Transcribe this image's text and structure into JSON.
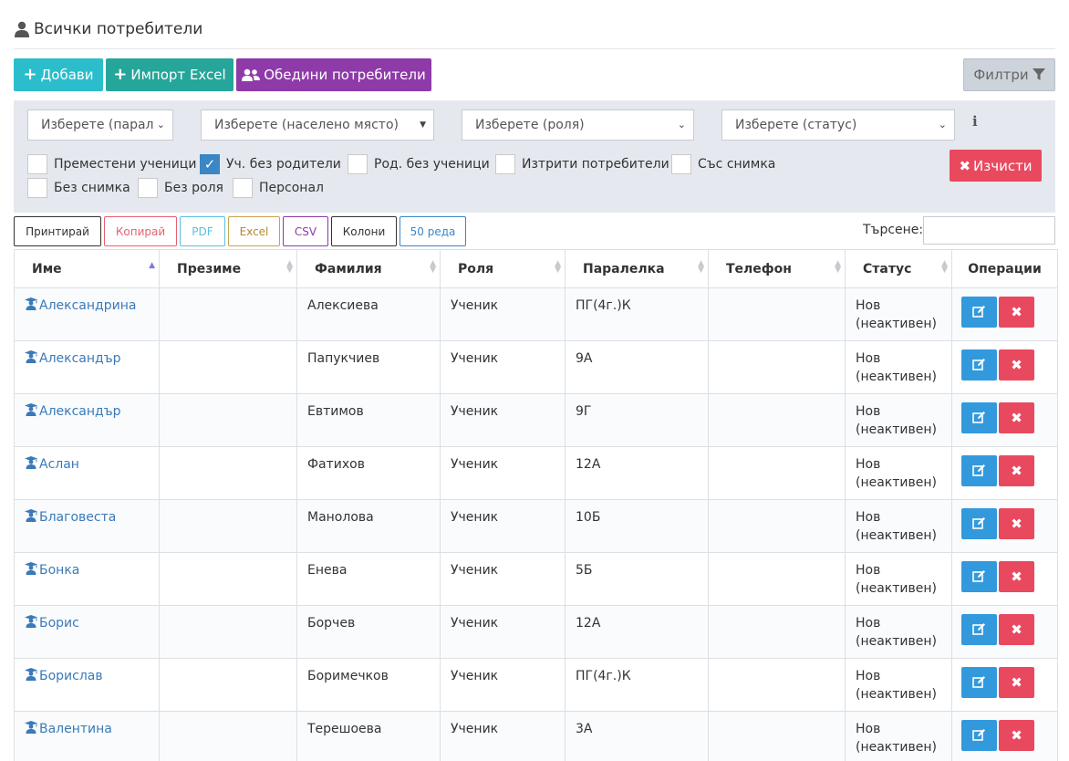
{
  "header": {
    "title": "Всички потребители"
  },
  "toolbar": {
    "add_label": "Добави",
    "import_label": "Импорт Excel",
    "merge_label": "Обедини потребители",
    "filters_label": "Филтри"
  },
  "filters": {
    "class_select": "Изберете (парал",
    "place_select": "Изберете (населено място)",
    "role_select": "Изберете (роля)",
    "status_select": "Изберете (статус)",
    "checkboxes": [
      {
        "label": "Преместени ученици",
        "checked": false
      },
      {
        "label": "Уч. без родители",
        "checked": true
      },
      {
        "label": "Род. без ученици",
        "checked": false
      },
      {
        "label": "Изтрити потребители",
        "checked": false
      },
      {
        "label": "Със снимка",
        "checked": false
      },
      {
        "label": "Без снимка",
        "checked": false
      },
      {
        "label": "Без роля",
        "checked": false
      },
      {
        "label": "Персонал",
        "checked": false
      }
    ],
    "clear_label": "Изчисти"
  },
  "export": {
    "print": "Принтирай",
    "copy": "Копирай",
    "pdf": "PDF",
    "excel": "Excel",
    "csv": "CSV",
    "columns": "Колони",
    "rows": "50 реда"
  },
  "search": {
    "label": "Търсене:",
    "value": ""
  },
  "table": {
    "headers": [
      "Име",
      "Презиме",
      "Фамилия",
      "Роля",
      "Паралелка",
      "Телефон",
      "Статус",
      "Операции"
    ],
    "rows": [
      {
        "first": "Александрина",
        "middle": "",
        "last": "Алексиева",
        "role": "Ученик",
        "class": "ПГ(4г.)К",
        "phone": "",
        "status": "Нов (неактивен)"
      },
      {
        "first": "Александър",
        "middle": "",
        "last": "Папукчиев",
        "role": "Ученик",
        "class": "9А",
        "phone": "",
        "status": "Нов (неактивен)"
      },
      {
        "first": "Александър",
        "middle": "",
        "last": "Евтимов",
        "role": "Ученик",
        "class": "9Г",
        "phone": "",
        "status": "Нов (неактивен)"
      },
      {
        "first": "Аслан",
        "middle": "",
        "last": "Фатихов",
        "role": "Ученик",
        "class": "12А",
        "phone": "",
        "status": "Нов (неактивен)"
      },
      {
        "first": "Благовеста",
        "middle": "",
        "last": "Манолова",
        "role": "Ученик",
        "class": "10Б",
        "phone": "",
        "status": "Нов (неактивен)"
      },
      {
        "first": "Бонка",
        "middle": "",
        "last": "Енева",
        "role": "Ученик",
        "class": "5Б",
        "phone": "",
        "status": "Нов (неактивен)"
      },
      {
        "first": "Борис",
        "middle": "",
        "last": "Борчев",
        "role": "Ученик",
        "class": "12А",
        "phone": "",
        "status": "Нов (неактивен)"
      },
      {
        "first": "Борислав",
        "middle": "",
        "last": "Боримечков",
        "role": "Ученик",
        "class": "ПГ(4г.)К",
        "phone": "",
        "status": "Нов (неактивен)"
      },
      {
        "first": "Валентина",
        "middle": "",
        "last": "Терешоева",
        "role": "Ученик",
        "class": "3А",
        "phone": "",
        "status": "Нов (неактивен)"
      }
    ]
  },
  "colors": {
    "add": "#2bbdcb",
    "import": "#26a69a",
    "merge": "#8e3aa8",
    "filter_panel": "#e5e9ef",
    "clear": "#e9495f",
    "edit": "#3399dd",
    "delete": "#e9495f",
    "link": "#3b7ab8"
  },
  "icons": {
    "header": "user-icon",
    "add": "plus-icon",
    "import": "plus-icon",
    "merge": "users-icon",
    "filters": "funnel-icon",
    "info": "info-icon",
    "clear": "times-icon",
    "row": "student-icon",
    "edit": "edit-icon",
    "delete": "delete-icon"
  }
}
